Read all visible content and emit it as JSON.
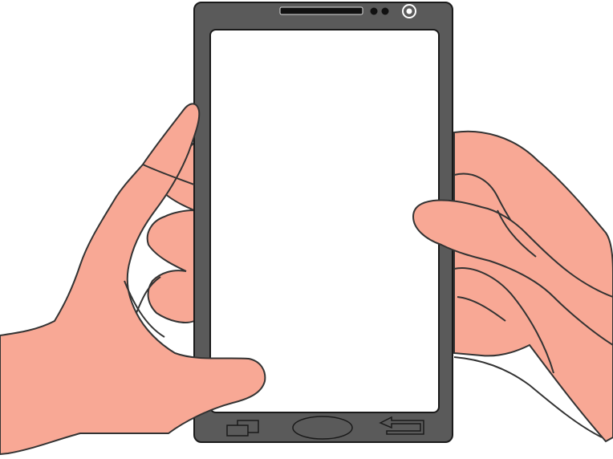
{
  "colors": {
    "background": "#ffffff",
    "skin": "#f8a895",
    "outline": "#333333",
    "phone_body": "#5a5a5a",
    "phone_screen": "#ffffff",
    "phone_detail": "#1a1a1a",
    "button_fill": "#5a5a5a"
  },
  "icons": {
    "recent_apps": "recent-apps-icon",
    "home": "home-button-icon",
    "back": "back-arrow-icon",
    "speaker": "speaker-grille-icon",
    "sensors": "sensor-dots-icon",
    "camera": "front-camera-icon"
  }
}
